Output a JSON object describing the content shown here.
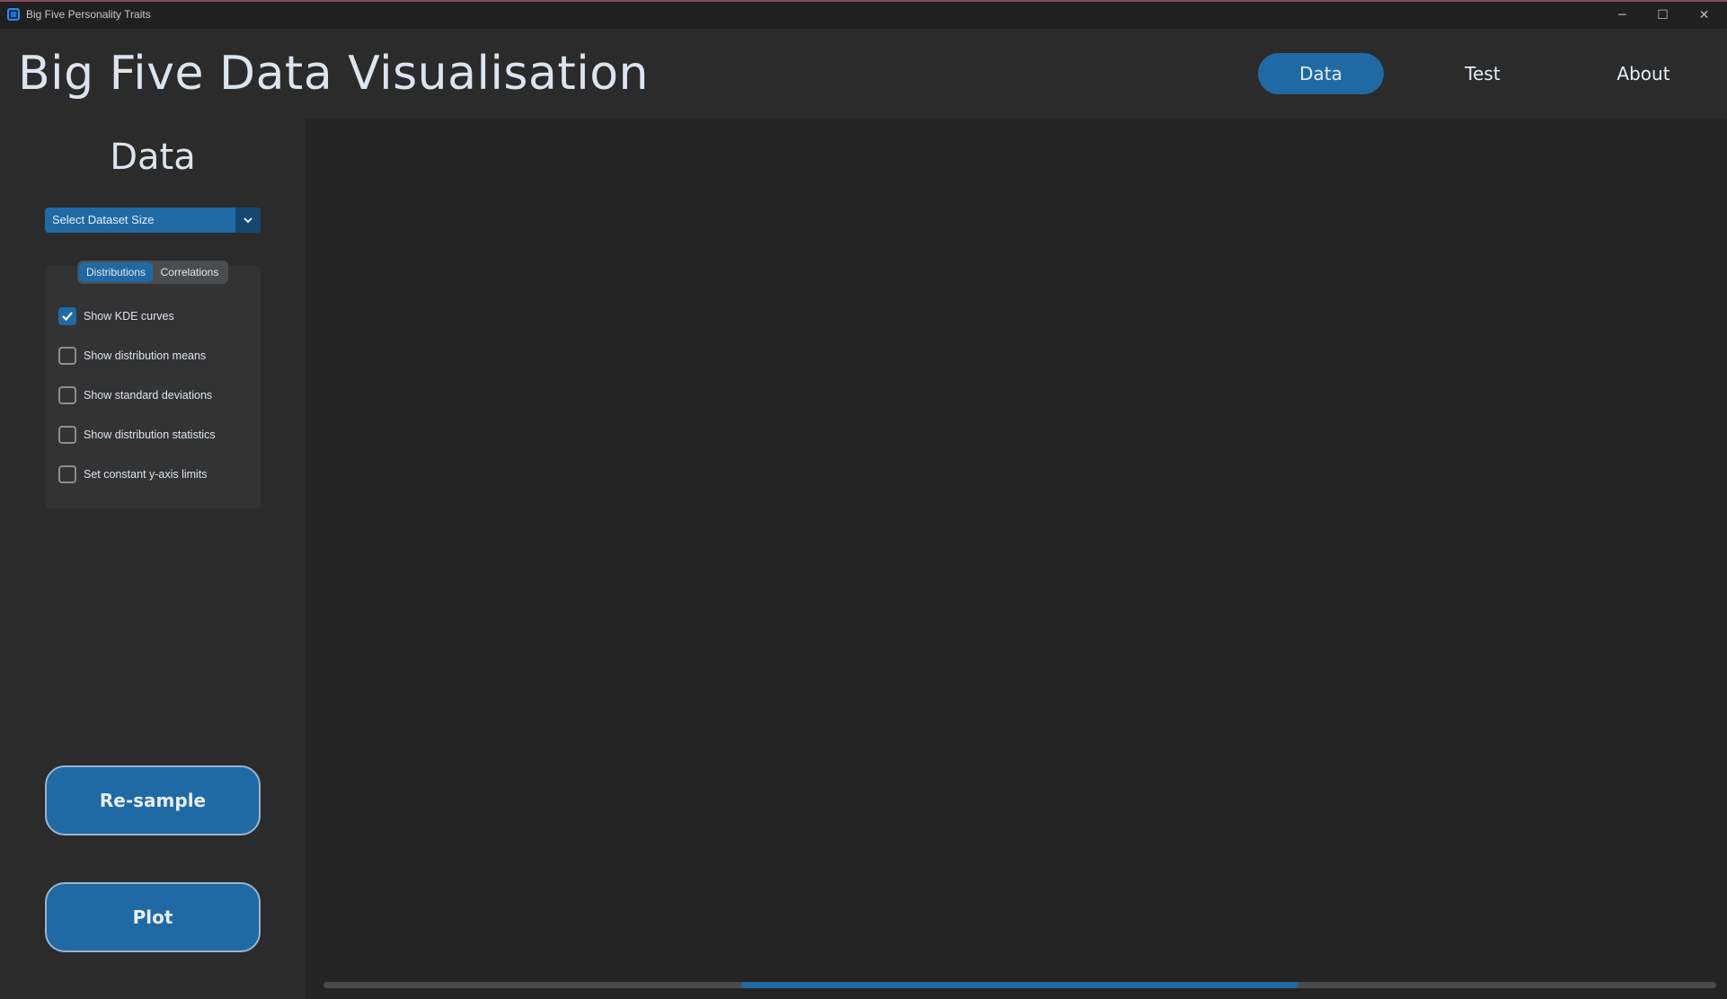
{
  "window": {
    "title": "Big Five Personality Traits",
    "controls": {
      "minimize": "─",
      "maximize": "☐",
      "close": "✕"
    }
  },
  "header": {
    "title": "Big Five Data Visualisation",
    "nav": [
      {
        "label": "Data",
        "active": true
      },
      {
        "label": "Test",
        "active": false
      },
      {
        "label": "About",
        "active": false
      }
    ]
  },
  "sidebar": {
    "title": "Data",
    "dataset_select": {
      "value": "Select Dataset Size"
    },
    "tabs": [
      {
        "label": "Distributions",
        "active": true
      },
      {
        "label": "Correlations",
        "active": false
      }
    ],
    "options": [
      {
        "label": "Show KDE curves",
        "checked": true
      },
      {
        "label": "Show distribution means",
        "checked": false
      },
      {
        "label": "Show standard deviations",
        "checked": false
      },
      {
        "label": "Show distribution statistics",
        "checked": false
      },
      {
        "label": "Set constant y-axis limits",
        "checked": false
      }
    ],
    "resample_label": "Re-sample",
    "plot_label": "Plot"
  },
  "plot_area": {
    "scrollbar": {
      "position_fraction": 0.3,
      "visible_fraction": 0.4
    }
  },
  "colors": {
    "accent": "#1f6aa5",
    "background": "#242424",
    "panel": "#2b2b2b",
    "text": "#dce4ee"
  }
}
